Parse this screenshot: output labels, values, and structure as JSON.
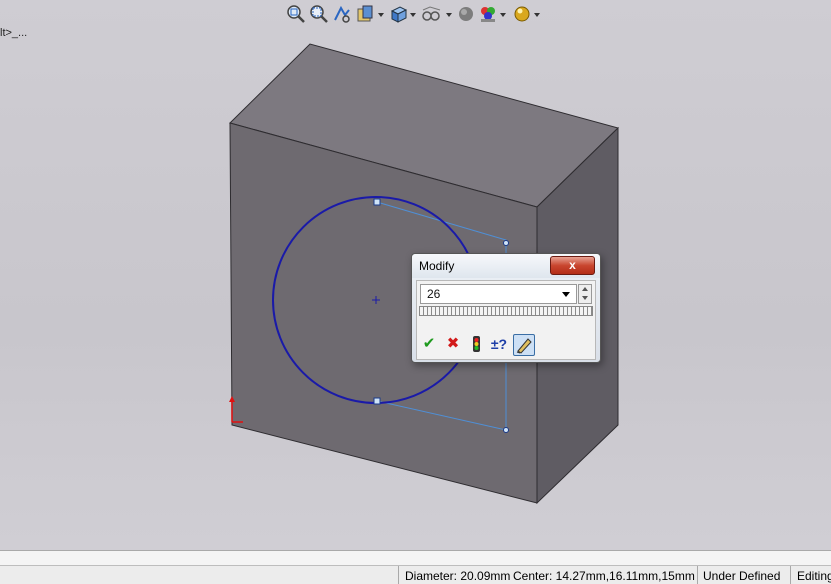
{
  "tree_stub": "lt>_...",
  "toolbar": {
    "icons": [
      "zoom-to-fit-icon",
      "zoom-to-area-icon",
      "previous-view-icon",
      "section-view-icon",
      "view-orientation-icon",
      "display-style-icon",
      "hide-show-items-icon",
      "edit-appearance-icon",
      "apply-scene-icon",
      "view-settings-icon"
    ]
  },
  "modify_dialog": {
    "title": "Modify",
    "close_label": "x",
    "value": "26",
    "actions": [
      "ok-check-icon",
      "cancel-x-icon",
      "rebuild-traffic-light-icon",
      "reverse-dimension-icon",
      "mark-for-drawing-icon"
    ],
    "plus_minus_label": "±?"
  },
  "status": {
    "diameter": "Diameter: 20.09mm",
    "center": "Center: 14.27mm,16.11mm,15mm",
    "state": "Under Defined",
    "mode": "Editing"
  },
  "colors": {
    "sketch_circle": "#1a1aa8",
    "construction_line": "#4f8fd6",
    "box_front": "#6e6a70",
    "box_top": "#7d7980",
    "box_side": "#5c5960",
    "close_button": "#c9462f"
  }
}
